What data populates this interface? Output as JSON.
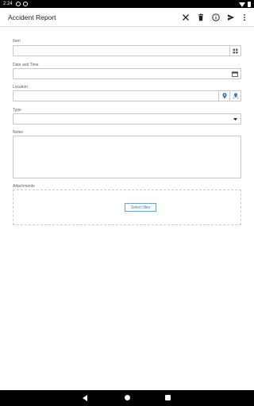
{
  "status_bar": {
    "time": "2:24"
  },
  "app_bar": {
    "title": "Accident Report",
    "actions": [
      {
        "name": "close-icon"
      },
      {
        "name": "delete-icon"
      },
      {
        "name": "info-icon"
      },
      {
        "name": "send-icon"
      },
      {
        "name": "more-vert-icon"
      }
    ]
  },
  "form": {
    "item_label": "Item",
    "item_value": "",
    "datetime_label": "Date and Time",
    "datetime_value": "",
    "location_label": "Location",
    "location_value": "",
    "type_label": "Type",
    "type_value": "",
    "notes_label": "Notes",
    "notes_value": "",
    "attachments_label": "Attachments",
    "select_files_label": "Select files"
  },
  "colors": {
    "accent": "#3e7ab8",
    "border": "#c8c8c8",
    "label": "#616161"
  }
}
